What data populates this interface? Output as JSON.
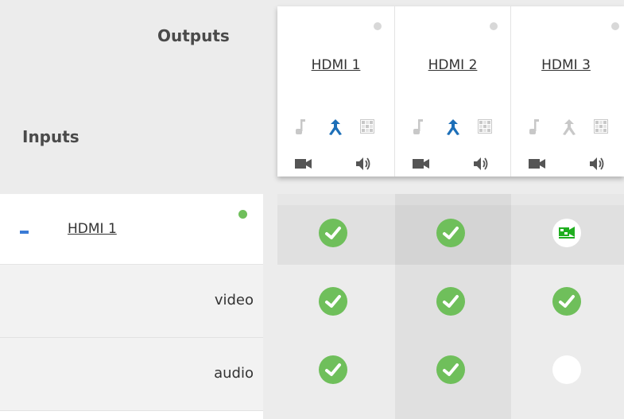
{
  "header": {
    "outputs_label": "Outputs",
    "inputs_label": "Inputs"
  },
  "outputs": [
    {
      "name": "HDMI 1",
      "status_color": "#d8d8d8",
      "icons": [
        "music-note-icon",
        "merge-arrow-icon",
        "pattern-grid-icon",
        "video-camera-icon",
        "speaker-icon"
      ],
      "merge_active": true
    },
    {
      "name": "HDMI 2",
      "status_color": "#d8d8d8",
      "icons": [
        "music-note-icon",
        "merge-arrow-icon",
        "pattern-grid-icon",
        "video-camera-icon",
        "speaker-icon"
      ],
      "merge_active": true
    },
    {
      "name": "HDMI 3",
      "status_color": "#d8d8d8",
      "icons": [
        "music-note-icon",
        "merge-arrow-icon",
        "pattern-grid-icon",
        "video-camera-icon",
        "speaker-icon"
      ],
      "merge_active": false
    }
  ],
  "inputs": [
    {
      "name": "HDMI 1",
      "status_color": "#6fbf5b",
      "expanded": true,
      "sub_rows": [
        {
          "label": "video"
        },
        {
          "label": "audio"
        }
      ]
    }
  ],
  "matrix": {
    "main": [
      "checked",
      "checked",
      "video-only"
    ],
    "video": [
      "checked",
      "checked",
      "checked"
    ],
    "audio": [
      "checked",
      "checked",
      "empty"
    ]
  },
  "colors": {
    "accent_blue": "#1d6fb8",
    "check_green": "#6fbf5b",
    "video_green": "#1fae1f",
    "icon_gray": "#555555",
    "icon_light_gray": "#c8c8c8"
  }
}
